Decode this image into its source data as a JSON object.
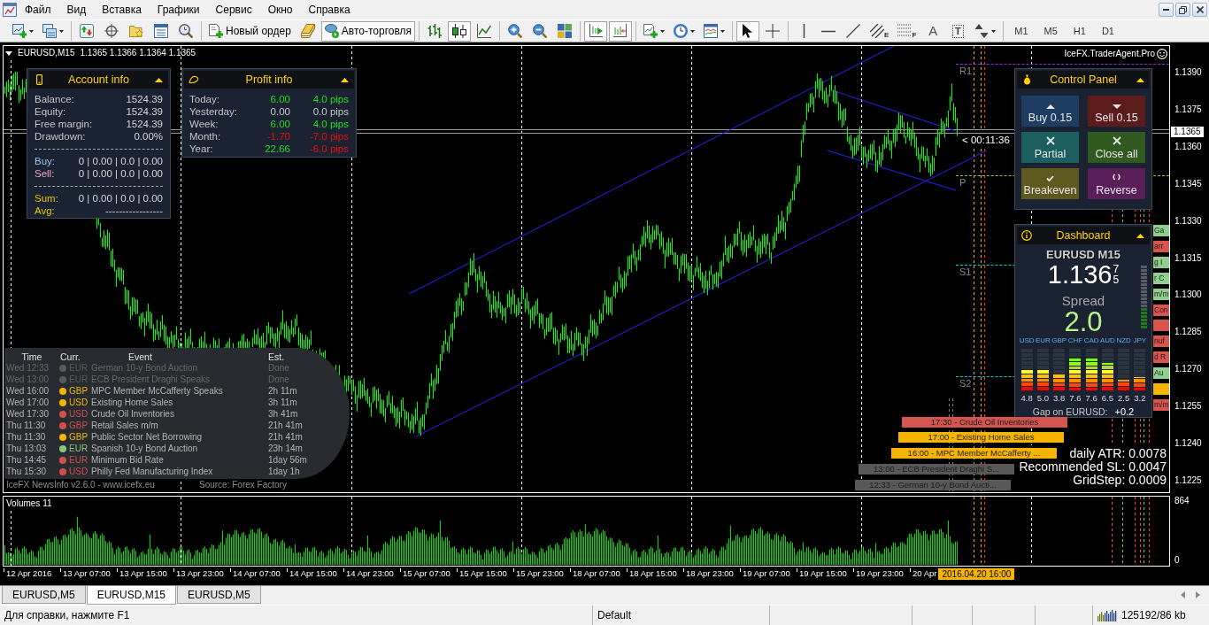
{
  "menu_bar": {
    "items": [
      "Файл",
      "Вид",
      "Вставка",
      "Графики",
      "Сервис",
      "Окно",
      "Справка"
    ]
  },
  "toolbar": {
    "groups": [
      [
        {
          "kind": "new-chart",
          "pressed": false,
          "dropdown": true
        },
        {
          "kind": "profiles",
          "pressed": false,
          "dropdown": true
        }
      ],
      [
        {
          "kind": "market-watch",
          "pressed": false
        },
        {
          "kind": "navigator",
          "pressed": false
        },
        {
          "kind": "favorites",
          "pressed": false
        },
        {
          "kind": "data-window",
          "pressed": false
        },
        {
          "kind": "tester",
          "pressed": false
        }
      ],
      [
        {
          "kind": "new-order",
          "label": "Новый ордер",
          "pressed": false
        },
        {
          "kind": "editor",
          "pressed": false
        },
        {
          "kind": "auto-trading",
          "label": "Авто-торговля",
          "pressed": true
        }
      ],
      [
        {
          "kind": "bar-chart",
          "pressed": false
        },
        {
          "kind": "candles",
          "pressed": true
        },
        {
          "kind": "line-chart",
          "pressed": false
        }
      ],
      [
        {
          "kind": "zoom-in",
          "pressed": false
        },
        {
          "kind": "zoom-out",
          "pressed": false
        },
        {
          "kind": "tile",
          "pressed": false
        }
      ],
      [
        {
          "kind": "chart-shift",
          "pressed": true
        },
        {
          "kind": "auto-scroll",
          "pressed": true
        }
      ],
      [
        {
          "kind": "indicators",
          "pressed": false,
          "dropdown": true
        },
        {
          "kind": "periods",
          "pressed": false,
          "dropdown": true
        },
        {
          "kind": "templates",
          "pressed": false,
          "dropdown": true
        }
      ],
      [
        {
          "kind": "cursor",
          "pressed": true
        },
        {
          "kind": "crosshair",
          "pressed": false
        }
      ],
      [
        {
          "kind": "vertical-line",
          "pressed": false
        },
        {
          "kind": "horizontal-line",
          "pressed": false
        },
        {
          "kind": "trend-line",
          "pressed": false
        },
        {
          "kind": "fibo-channel",
          "label": "E",
          "pressed": false
        },
        {
          "kind": "fibo-levels",
          "label": "F",
          "pressed": false
        },
        {
          "kind": "text",
          "label": "A",
          "pressed": false
        },
        {
          "kind": "text-label",
          "label": "T",
          "pressed": false
        },
        {
          "kind": "arrows",
          "pressed": false,
          "dropdown": true
        }
      ],
      [
        {
          "kind": "period",
          "label": "M1",
          "pressed": false
        },
        {
          "kind": "period",
          "label": "M5",
          "pressed": false
        },
        {
          "kind": "period",
          "label": "H1",
          "pressed": false
        },
        {
          "kind": "period",
          "label": "D1",
          "pressed": false
        }
      ]
    ]
  },
  "chart": {
    "symbol": "EURUSD,M15",
    "quote": "1.1365 1.1366 1.1364 1.1365",
    "expert": "IceFX.TraderAgent.Pro",
    "price_axis": [
      "1.1390",
      "1.1375",
      "1.1360",
      "1.1345",
      "1.1330",
      "1.1315",
      "1.1300",
      "1.1285",
      "1.1270",
      "1.1255",
      "1.1240",
      "1.1225"
    ],
    "current_price": "1.1365",
    "pivots": [
      {
        "label": "R1",
        "color": "#a020f0"
      },
      {
        "label": "P",
        "color": "#9acd32"
      },
      {
        "label": "S1",
        "color": "#00ced1"
      },
      {
        "label": "S2",
        "color": "#00ced1"
      }
    ],
    "countdown": "< 00:11:36",
    "account_info": {
      "title": "Account info",
      "rows": [
        {
          "label": "Balance:",
          "value": "1524.39"
        },
        {
          "label": "Equity:",
          "value": "1524.39"
        },
        {
          "label": "Free margin:",
          "value": "1524.39"
        },
        {
          "label": "Drawdown:",
          "value": "0.00%"
        }
      ],
      "positions": [
        {
          "label": "Buy:",
          "value": "0 | 0.00 | 0.0 | 0.00",
          "color": "#9cc4f0"
        },
        {
          "label": "Sell:",
          "value": "0 | 0.00 | 0.0 | 0.00",
          "color": "#f0a8c0"
        }
      ],
      "totals": [
        {
          "label": "Sum:",
          "value": "0 | 0.00 | 0.0 | 0.00"
        },
        {
          "label": "Avg:",
          "value": "-----------------"
        }
      ]
    },
    "profit_info": {
      "title": "Profit info",
      "rows": [
        {
          "label": "Today:",
          "amount": {
            "text": "6.00",
            "color": "#22dd22"
          },
          "pips": {
            "text": "4.0 pips",
            "color": "#22dd22"
          }
        },
        {
          "label": "Yesterday:",
          "amount": {
            "text": "0.00",
            "color": "#c8c8c8"
          },
          "pips": {
            "text": "0.0 pips",
            "color": "#c8c8c8"
          }
        },
        {
          "label": "Week:",
          "amount": {
            "text": "6.00",
            "color": "#22dd22"
          },
          "pips": {
            "text": "4.0 pips",
            "color": "#22dd22"
          }
        },
        {
          "label": "Month:",
          "amount": {
            "text": "-1.70",
            "color": "#e81010"
          },
          "pips": {
            "text": "-7.0 pips",
            "color": "#e81010"
          }
        },
        {
          "label": "Year:",
          "amount": {
            "text": "22.66",
            "color": "#22dd22"
          },
          "pips": {
            "text": "-6.0 pips",
            "color": "#e81010"
          }
        }
      ]
    },
    "news_info": {
      "columns": [
        "Time",
        "Curr.",
        "Event",
        "Est."
      ],
      "rows": [
        {
          "time": "Wed 12:33",
          "color": "#5a5a5a",
          "currency": "EUR",
          "event": "German 10-y Bond Auction",
          "estimate": "Done",
          "past": true
        },
        {
          "time": "Wed 13:00",
          "color": "#5a5a5a",
          "currency": "EUR",
          "event": "ECB President Draghi Speaks",
          "estimate": "Done",
          "past": true
        },
        {
          "time": "Wed 16:00",
          "color": "#f5b400",
          "currency": "GBP",
          "event": "MPC Member McCafferty Speaks",
          "estimate": "2h 11m",
          "past": false
        },
        {
          "time": "Wed 17:00",
          "color": "#f5b400",
          "currency": "USD",
          "event": "Existing Home Sales",
          "estimate": "3h 11m",
          "past": false
        },
        {
          "time": "Wed 17:30",
          "color": "#d0504c",
          "currency": "USD",
          "event": "Crude Oil Inventories",
          "estimate": "3h 41m",
          "past": false
        },
        {
          "time": "Thu 11:30",
          "color": "#d0504c",
          "currency": "GBP",
          "event": "Retail Sales m/m",
          "estimate": "21h 41m",
          "past": false
        },
        {
          "time": "Thu 11:30",
          "color": "#f5b400",
          "currency": "GBP",
          "event": "Public Sector Net Borrowing",
          "estimate": "21h 41m",
          "past": false
        },
        {
          "time": "Thu 13:03",
          "color": "#80c880",
          "currency": "EUR",
          "event": "Spanish 10-y Bond Auction",
          "estimate": "23h 14m",
          "past": false
        },
        {
          "time": "Thu 14:45",
          "color": "#d0504c",
          "currency": "EUR",
          "event": "Minimum Bid Rate",
          "estimate": "1day 56m",
          "past": false
        },
        {
          "time": "Thu 15:30",
          "color": "#d0504c",
          "currency": "USD",
          "event": "Philly Fed Manufacturing Index",
          "estimate": "1day 1h",
          "past": false
        }
      ],
      "footer": "IceFX NewsInfo v2.6.0 - www.icefx.eu",
      "source": "Source: Forex Factory"
    },
    "control_panel": {
      "title": "Control Panel",
      "buttons": [
        {
          "label": "Buy 0.15",
          "kind": "up",
          "color": "#1f3c62"
        },
        {
          "label": "Sell 0.15",
          "kind": "down",
          "color": "#5c1c1c"
        },
        {
          "label": "Partial",
          "kind": "cross",
          "color": "#1c5f5f"
        },
        {
          "label": "Close all",
          "kind": "cross",
          "color": "#305a20"
        },
        {
          "label": "Breakeven",
          "kind": "check",
          "color": "#5c5a1e"
        },
        {
          "label": "Reverse",
          "kind": "cycle",
          "color": "#5a1e5a"
        }
      ]
    },
    "dashboard": {
      "title": "Dashboard",
      "symbol": "EURUSD M15",
      "price": "1.136",
      "price_high_digit": "7",
      "price_low_digit": "5",
      "spread_label": "Spread",
      "spread": "2.0",
      "currencies": [
        {
          "code": "USD",
          "value": "4.8",
          "level": 0.48
        },
        {
          "code": "EUR",
          "value": "5.0",
          "level": 0.5
        },
        {
          "code": "GBP",
          "value": "3.8",
          "level": 0.38
        },
        {
          "code": "CHF",
          "value": "7.6",
          "level": 0.76
        },
        {
          "code": "CAD",
          "value": "7.6",
          "level": 0.76
        },
        {
          "code": "AUD",
          "value": "6.5",
          "level": 0.65
        },
        {
          "code": "NZD",
          "value": "2.5",
          "level": 0.25
        },
        {
          "code": "JPY",
          "value": "3.2",
          "level": 0.32
        }
      ],
      "gap_label": "Gap on EURUSD:",
      "gap": "+0.2"
    },
    "side_news_tags": [
      {
        "text": "Ga",
        "color": "#8fd08f"
      },
      {
        "text": "arr",
        "color": "#d9534f"
      },
      {
        "text": "g I",
        "color": "#8fd08f"
      },
      {
        "text": "r C",
        "color": "#8fd08f"
      },
      {
        "text": "m/m",
        "color": "#8fd08f"
      },
      {
        "text": "Con",
        "color": "#d9534f"
      },
      {
        "color": "#d9534f"
      },
      {
        "text": "nuf",
        "color": "#d9534f"
      },
      {
        "text": "d R",
        "color": "#d9534f"
      },
      {
        "text": "Au",
        "color": "#8fd08f"
      },
      {
        "color": "#f5b400"
      },
      {
        "text": "m/m",
        "color": "#d9534f"
      }
    ],
    "news_bars": [
      {
        "text": "17:30 - Crude Oil Inventories",
        "color": "#d35450"
      },
      {
        "text": "17:00 - Existing Home Sales",
        "color": "#f4b400"
      },
      {
        "text": "16:00 - MPC Member McCafferty ...",
        "color": "#f4b400"
      },
      {
        "text": "13:00 - ECB President Draghi S...",
        "color": "#585858"
      },
      {
        "text": "12:33 - German 10-y Bond Aucti...",
        "color": "#585858"
      }
    ],
    "atr_info": [
      "daily ATR: 0.0078",
      "Recommended SL: 0.0047",
      "GridStep: 0.0009"
    ],
    "volume_pane": {
      "title": "Volumes 11",
      "axis": [
        "864",
        "0"
      ]
    },
    "time_axis": [
      "12 Apr 2016",
      "13 Apr 07:00",
      "13 Apr 15:00",
      "13 Apr 23:00",
      "14 Apr 07:00",
      "14 Apr 15:00",
      "14 Apr 23:00",
      "15 Apr 07:00",
      "15 Apr 15:00",
      "15 Apr 23:00",
      "18 Apr 07:00",
      "18 Apr 15:00",
      "18 Apr 23:00",
      "19 Apr 07:00",
      "19 Apr 15:00",
      "19 Apr 23:00",
      "20 Apr"
    ],
    "cursor_time": "2016.04.20 16:00"
  },
  "tabs": [
    {
      "label": "EURUSD,M5",
      "selected": false
    },
    {
      "label": "EURUSD,M15",
      "selected": true
    },
    {
      "label": "EURUSD,M5",
      "selected": false
    }
  ],
  "status_bar": {
    "help": "Для справки, нажмите F1",
    "profile": "Default",
    "memory": "125192/86 kb"
  }
}
